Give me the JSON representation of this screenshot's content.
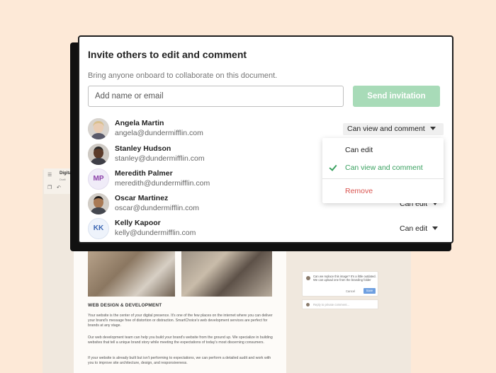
{
  "modal": {
    "title": "Invite others to edit and comment",
    "subtitle": "Bring anyone onboard to collaborate on this document.",
    "input_placeholder": "Add name or email",
    "send_label": "Send invitation"
  },
  "people": [
    {
      "name": "Angela Martin",
      "email": "angela@dundermifflin.com",
      "permission": "Can view and comment",
      "initials": ""
    },
    {
      "name": "Stanley Hudson",
      "email": "stanley@dundermifflin.com",
      "permission": "",
      "initials": ""
    },
    {
      "name": "Meredith Palmer",
      "email": "meredith@dundermifflin.com",
      "permission": "",
      "initials": "MP"
    },
    {
      "name": "Oscar Martinez",
      "email": "oscar@dundermifflin.com",
      "permission": "Can edit",
      "initials": ""
    },
    {
      "name": "Kelly Kapoor",
      "email": "kelly@dundermifflin.com",
      "permission": "Can edit",
      "initials": "KK"
    }
  ],
  "menu": {
    "items": [
      "Can edit",
      "Can view and comment",
      "Remove"
    ],
    "selected": "Can view and comment"
  },
  "document": {
    "toolbar_title": "Digita",
    "toolbar_sub": "Draft",
    "heading": "WEB DESIGN & DEVELOPMENT",
    "paragraphs": [
      "Your website is the center of your digital presence. It's one of the few places on the internet where you can deliver your brand's message free of distortion or distraction. SmartChoice's web development services are perfect for brands at any stage.",
      "Our web development team can help you build your brand's website from the ground up. We specialize in building websites that tell a unique brand story while meeting the expectations of today's most discerning consumers.",
      "If your website is already built but isn't performing to expectations, we can perform a detailed audit and work with you to improve site architecture, design, and responsiveness."
    ],
    "comment": {
      "text": "Can we replace this image? It's a little outdated. We can upload one from the branding folder",
      "cancel": "Cancel",
      "save": "Save",
      "reply_placeholder": "Reply to private comment..."
    }
  },
  "colors": {
    "background": "#fde9d7",
    "send_button": "#a8dbb8",
    "selected_green": "#3aa160",
    "remove_red": "#d9534f",
    "mp_initials": "#8b3fa8",
    "kk_initials": "#3b66b3"
  },
  "icons": [
    "hamburger-icon",
    "copy-icon",
    "undo-icon",
    "chevron-down-icon",
    "checkmark-icon"
  ]
}
